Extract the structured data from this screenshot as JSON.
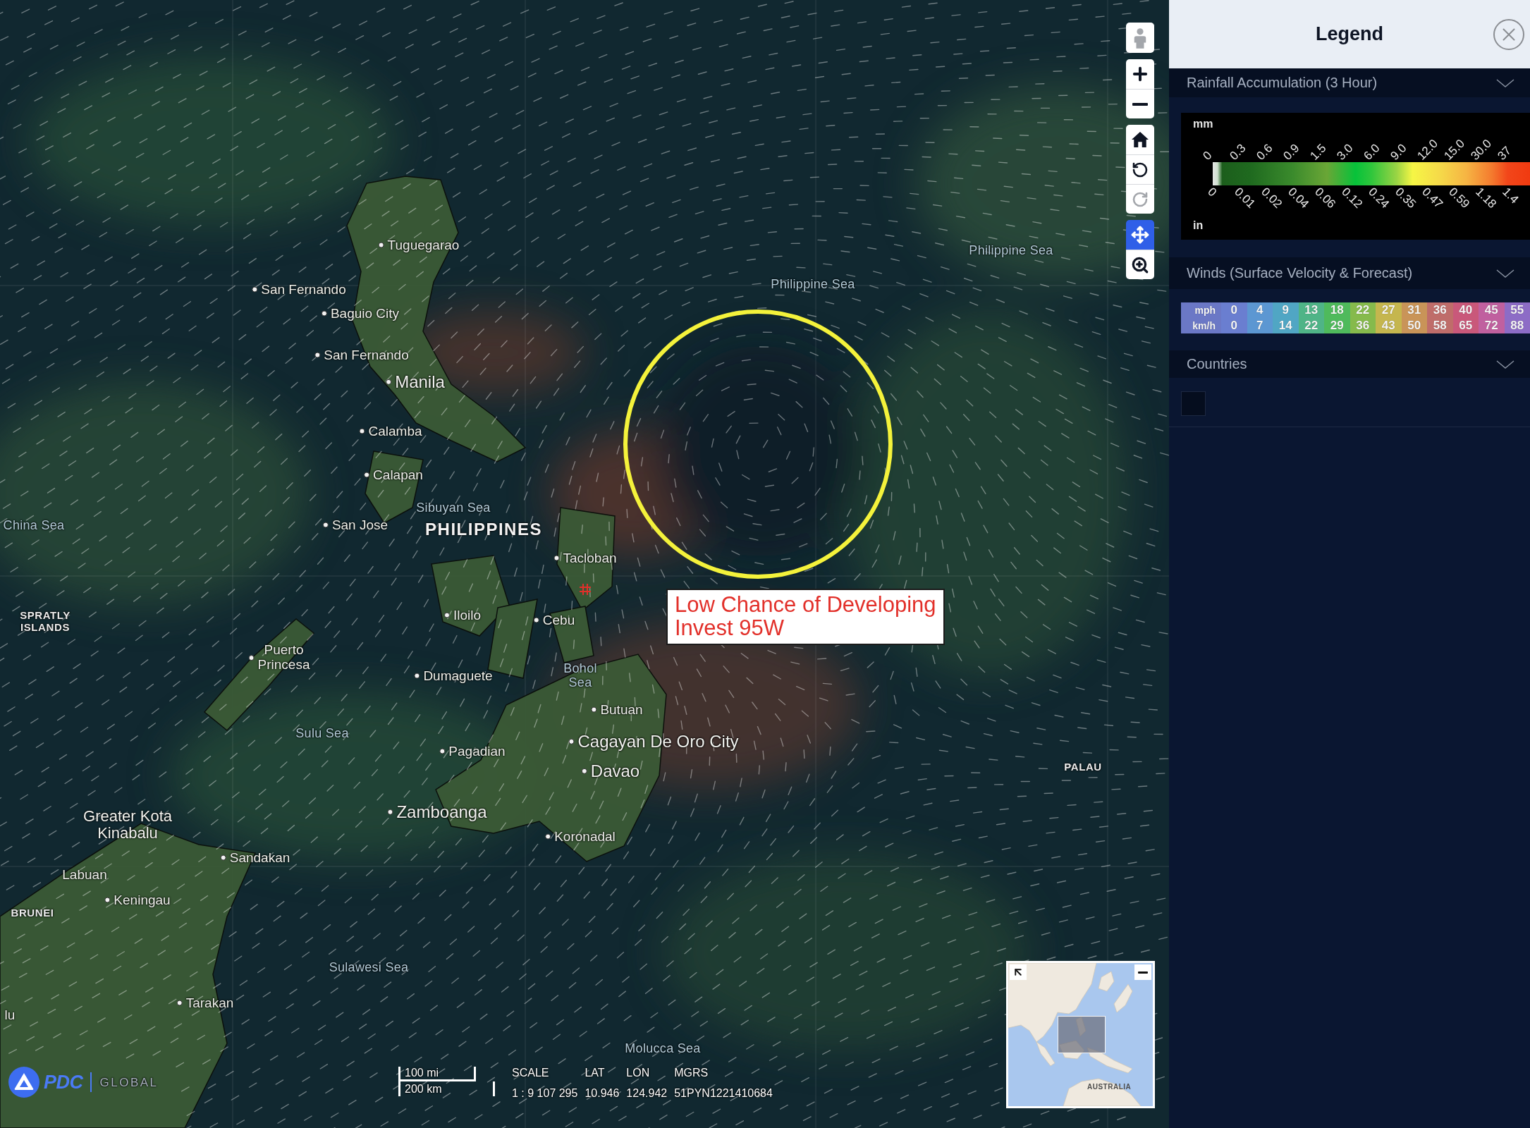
{
  "map": {
    "labels": [
      {
        "text": "Tuguegarao",
        "kind": "city"
      },
      {
        "text": "Philippine Sea",
        "kind": "water"
      },
      {
        "text": "San Fernando",
        "kind": "city"
      },
      {
        "text": "Philippine Sea",
        "kind": "water"
      },
      {
        "text": "Baguio City",
        "kind": "city"
      },
      {
        "text": "San Fernando",
        "kind": "city"
      },
      {
        "text": "Manila",
        "kind": "major"
      },
      {
        "text": "Calamba",
        "kind": "city"
      },
      {
        "text": "Calapan",
        "kind": "city"
      },
      {
        "text": "Sibuyan Sea",
        "kind": "water"
      },
      {
        "text": "China Sea",
        "kind": "water"
      },
      {
        "text": "San Jose",
        "kind": "city"
      },
      {
        "text": "PHILIPPINES",
        "kind": "country"
      },
      {
        "text": "Tacloban",
        "kind": "city"
      },
      {
        "text": "SPRATLY\nISLANDS",
        "kind": "region"
      },
      {
        "text": "Iloilo",
        "kind": "city"
      },
      {
        "text": "Cebu",
        "kind": "city"
      },
      {
        "text": "Puerto\nPrincesa",
        "kind": "city"
      },
      {
        "text": "Dumaguete",
        "kind": "city"
      },
      {
        "text": "Bohol\nSea",
        "kind": "water"
      },
      {
        "text": "Butuan",
        "kind": "city"
      },
      {
        "text": "Sulu Sea",
        "kind": "water"
      },
      {
        "text": "Cagayan De Oro City",
        "kind": "major"
      },
      {
        "text": "Pagadian",
        "kind": "city"
      },
      {
        "text": "Davao",
        "kind": "major"
      },
      {
        "text": "PALAU",
        "kind": "region"
      },
      {
        "text": "Zamboanga",
        "kind": "major"
      },
      {
        "text": "Greater Kota\nKinabalu",
        "kind": "large"
      },
      {
        "text": "Koronadal",
        "kind": "city"
      },
      {
        "text": "Sandakan",
        "kind": "city"
      },
      {
        "text": "Labuan",
        "kind": "place"
      },
      {
        "text": "Keningau",
        "kind": "city"
      },
      {
        "text": "BRUNEI",
        "kind": "region"
      },
      {
        "text": "Sulawesi Sea",
        "kind": "water"
      },
      {
        "text": "Tarakan",
        "kind": "city"
      },
      {
        "text": "lu",
        "kind": "place"
      },
      {
        "text": "Molucca Sea",
        "kind": "water"
      }
    ],
    "annotations": [
      {
        "kind": "circle"
      },
      {
        "kind": "marker"
      },
      {
        "kind": "callout",
        "lines": [
          "Low Chance of Developing",
          "Invest 95W"
        ]
      }
    ]
  },
  "map_toolbar": [
    {
      "tools": [
        {
          "kind": "person",
          "selected": false,
          "disabled": true
        }
      ]
    },
    {
      "tools": [
        {
          "kind": "zoom-in",
          "selected": false,
          "disabled": false
        },
        {
          "kind": "zoom-out",
          "selected": false,
          "disabled": false
        }
      ]
    },
    {
      "tools": [
        {
          "kind": "home",
          "selected": false,
          "disabled": false
        },
        {
          "kind": "rotate-left",
          "selected": false,
          "disabled": false
        },
        {
          "kind": "rotate-right",
          "selected": false,
          "disabled": true
        }
      ]
    },
    {
      "tools": [
        {
          "kind": "pan",
          "selected": true,
          "disabled": false
        },
        {
          "kind": "zoom-area",
          "selected": false,
          "disabled": false
        }
      ]
    }
  ],
  "logo": {
    "name": "PDC",
    "tagline": "GLOBAL"
  },
  "scale_bar": {
    "top": "100 mi",
    "bottom": "200 km"
  },
  "readouts": [
    {
      "label": "SCALE",
      "value": "1 : 9 107 295"
    },
    {
      "label": "LAT",
      "value": "10.946"
    },
    {
      "label": "LON",
      "value": "124.942"
    },
    {
      "label": "MGRS",
      "value": "51PYN1221410684"
    }
  ],
  "overview_map": {
    "labels": [
      "AUSTRALIA"
    ]
  },
  "legend": {
    "title": "Legend",
    "sections": [
      {
        "kind": "ramp",
        "title": "Rainfall Accumulation (3 Hour)",
        "top_unit": "mm",
        "top_ticks": [
          "0",
          "0.3",
          "0.6",
          "0.9",
          "1.5",
          "3.0",
          "6.0",
          "9.0",
          "12.0",
          "15.0",
          "30.0",
          "37"
        ],
        "bottom_ticks": [
          "0",
          "0.01",
          "0.02",
          "0.04",
          "0.06",
          "0.12",
          "0.24",
          "0.35",
          "0.47",
          "0.59",
          "1.18",
          "1.4"
        ],
        "bottom_unit": "in"
      },
      {
        "kind": "table",
        "title": "Winds (Surface Velocity & Forecast)",
        "columns": [
          {
            "kind": "units",
            "values": [
              "mph",
              "km/h"
            ],
            "color": "#6b78c6"
          },
          {
            "kind": "speed",
            "values": [
              "0",
              "0"
            ],
            "color": "#6a7ed0"
          },
          {
            "kind": "speed",
            "values": [
              "4",
              "7"
            ],
            "color": "#5c97d2"
          },
          {
            "kind": "speed",
            "values": [
              "9",
              "14"
            ],
            "color": "#50a6c4"
          },
          {
            "kind": "speed",
            "values": [
              "13",
              "22"
            ],
            "color": "#4fb487"
          },
          {
            "kind": "speed",
            "values": [
              "18",
              "29"
            ],
            "color": "#4fba5c"
          },
          {
            "kind": "speed",
            "values": [
              "22",
              "36"
            ],
            "color": "#86ba4c"
          },
          {
            "kind": "speed",
            "values": [
              "27",
              "43"
            ],
            "color": "#c5b64e"
          },
          {
            "kind": "speed",
            "values": [
              "31",
              "50"
            ],
            "color": "#c99458"
          },
          {
            "kind": "speed",
            "values": [
              "36",
              "58"
            ],
            "color": "#bf6d6a"
          },
          {
            "kind": "speed",
            "values": [
              "40",
              "65"
            ],
            "color": "#c9587a"
          },
          {
            "kind": "speed",
            "values": [
              "45",
              "72"
            ],
            "color": "#c0609f"
          },
          {
            "kind": "speed",
            "values": [
              "55",
              "88"
            ],
            "color": "#8d6cc6"
          }
        ]
      },
      {
        "kind": "swatches",
        "title": "Countries"
      }
    ]
  }
}
